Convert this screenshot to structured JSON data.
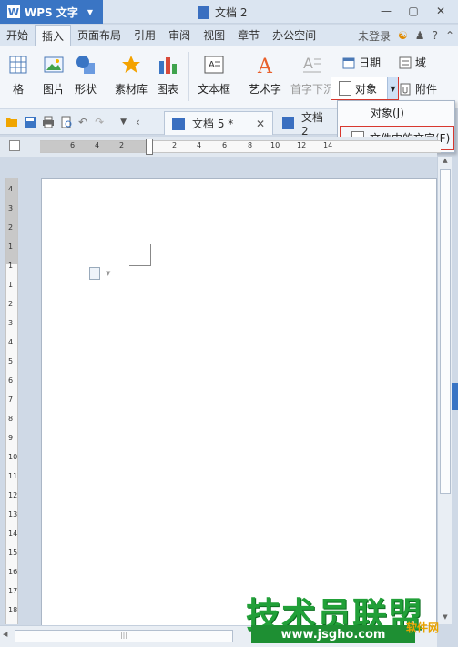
{
  "titlebar": {
    "app_name": "WPS 文字",
    "doc_title": "文档 2"
  },
  "menu": {
    "tabs": [
      "开始",
      "插入",
      "页面布局",
      "引用",
      "审阅",
      "视图",
      "章节",
      "办公空间"
    ],
    "active_index": 1,
    "login": "未登录"
  },
  "ribbon": {
    "table": "格",
    "picture": "图片",
    "shape": "形状",
    "library": "素材库",
    "chart": "图表",
    "textbox": "文本框",
    "wordart": "艺术字",
    "dropcap": "首字下沉",
    "date": "日期",
    "field": "域",
    "object": "对象",
    "attachment": "附件"
  },
  "object_menu": {
    "item1": "对象(J)",
    "item2": "文件中的文字(F)"
  },
  "doc_tabs": {
    "tab1": "文档 5 *",
    "tab2": "文档 2"
  },
  "ruler": {
    "h_marks": [
      "6",
      "4",
      "2",
      "2",
      "4",
      "6",
      "8",
      "10",
      "12",
      "14"
    ],
    "v_marks": [
      "4",
      "3",
      "2",
      "1",
      "1",
      "1",
      "2",
      "3",
      "4",
      "5",
      "6",
      "7",
      "8",
      "9",
      "10",
      "11",
      "12",
      "13",
      "14",
      "15",
      "16",
      "17",
      "18"
    ]
  },
  "watermark": {
    "text": "技术员联盟",
    "url": "www.jsgho.com",
    "tag": "软件网"
  },
  "colors": {
    "accent": "#3a75c4",
    "highlight": "#d8382f",
    "watermark": "#21a038"
  }
}
